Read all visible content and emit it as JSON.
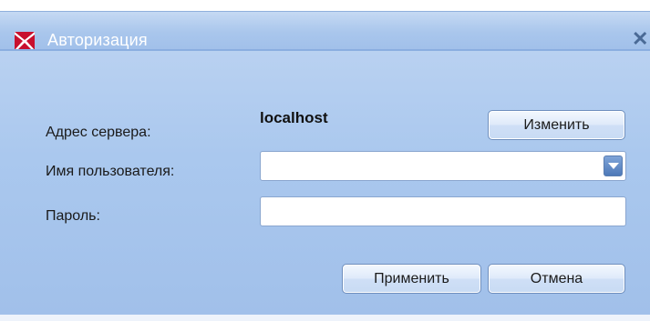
{
  "window": {
    "title": "Авторизация",
    "icon": "app-logo-icon",
    "close_icon": "close-icon"
  },
  "form": {
    "server_label": "Адрес сервера:",
    "server_value": "localhost",
    "change_button": "Изменить",
    "username_label": "Имя пользователя:",
    "username_value": "",
    "password_label": "Пароль:",
    "password_value": ""
  },
  "actions": {
    "apply_button": "Применить",
    "cancel_button": "Отмена"
  },
  "colors": {
    "title_bar": "#a9c6ec",
    "content_bg": "#aac8ee",
    "logo_red": "#c8102e"
  }
}
